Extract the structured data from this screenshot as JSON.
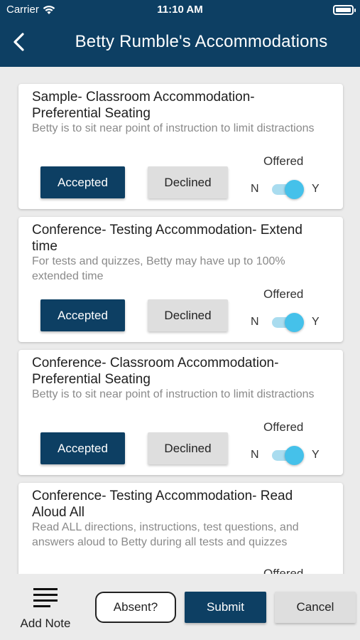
{
  "status_bar": {
    "carrier": "Carrier",
    "time": "11:10 AM"
  },
  "header": {
    "title": "Betty Rumble's Accommodations"
  },
  "accommodations": [
    {
      "title": "Sample- Classroom Accommodation- Preferential Seating",
      "description": "Betty is to sit near point of instruction to limit distractions",
      "accept_label": "Accepted",
      "decline_label": "Declined",
      "offered_label": "Offered",
      "toggle_off_label": "N",
      "toggle_on_label": "Y",
      "offered": true
    },
    {
      "title": "Conference- Testing Accommodation- Extend time",
      "description": "For tests and quizzes, Betty may have up to 100% extended time",
      "accept_label": "Accepted",
      "decline_label": "Declined",
      "offered_label": "Offered",
      "toggle_off_label": "N",
      "toggle_on_label": "Y",
      "offered": true
    },
    {
      "title": "Conference- Classroom Accommodation- Preferential Seating",
      "description": "Betty is to sit near point of instruction to limit distractions",
      "accept_label": "Accepted",
      "decline_label": "Declined",
      "offered_label": "Offered",
      "toggle_off_label": "N",
      "toggle_on_label": "Y",
      "offered": true
    },
    {
      "title": "Conference- Testing Accommodation- Read Aloud All",
      "description": "Read ALL directions, instructions, test questions, and answers aloud to Betty during all tests and quizzes",
      "offered_label": "Offered"
    }
  ],
  "footer": {
    "add_note_label": "Add Note",
    "absent_label": "Absent?",
    "submit_label": "Submit",
    "cancel_label": "Cancel"
  },
  "colors": {
    "primary": "#0d3f63",
    "toggle_on": "#45c1ea",
    "background": "#ebebeb"
  }
}
